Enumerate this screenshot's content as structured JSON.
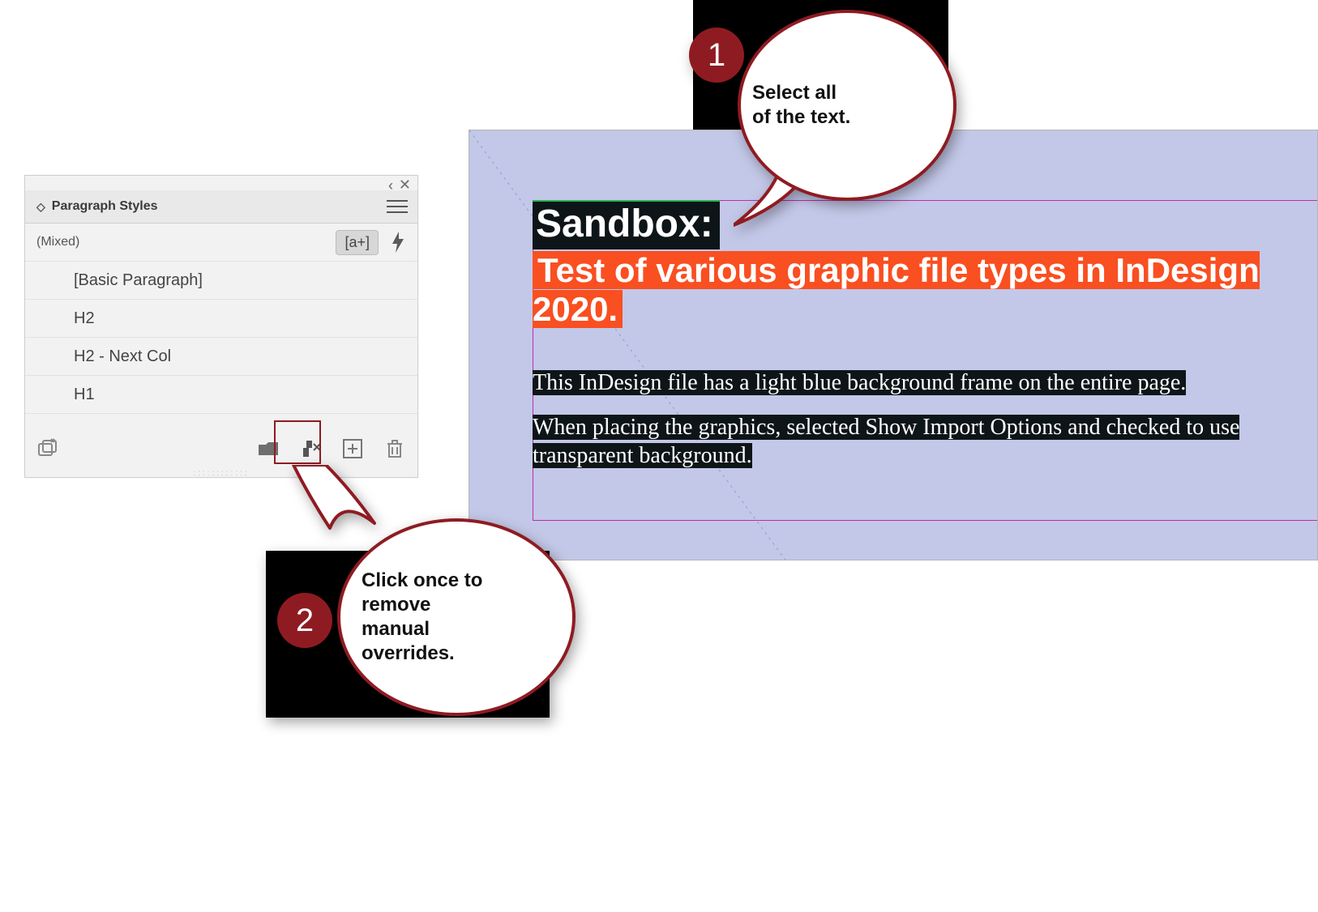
{
  "panel": {
    "title": "Paragraph Styles",
    "mixed_label": "(Mixed)",
    "override_chip": "[a+]",
    "styles": [
      {
        "label": "[Basic Paragraph]"
      },
      {
        "label": "H2"
      },
      {
        "label": "H2 - Next Col"
      },
      {
        "label": "H1"
      }
    ]
  },
  "document": {
    "heading": "Sandbox:",
    "subheading": "Test of various graphic file types in InDesign 2020.",
    "para1": "This InDesign file has a light blue background frame on the entire page.",
    "para2": "When placing the graphics, selected Show Import Options and checked to use transparent background."
  },
  "callouts": {
    "c1": {
      "num": "1",
      "text": "Select all of the text."
    },
    "c2": {
      "num": "2",
      "text": "Click once to remove manual overrides."
    }
  }
}
